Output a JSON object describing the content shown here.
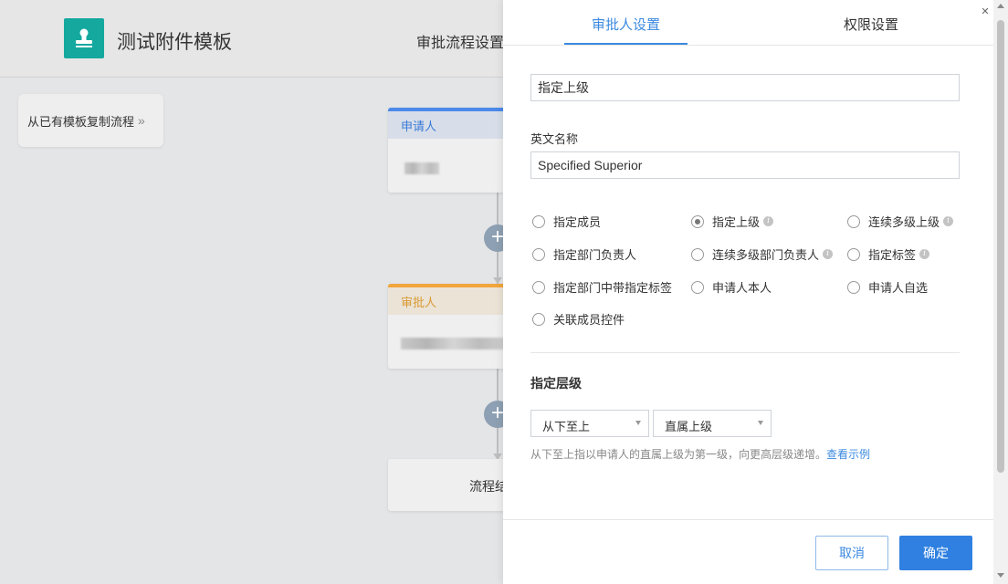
{
  "app": {
    "title": "测试附件模板",
    "top_tab": "审批流程设置",
    "copy_button": "从已有模板复制流程",
    "copy_chevron": "»",
    "logo_icon": "stamp-icon"
  },
  "flow": {
    "node1_label": "申请人",
    "node2_label": "审批人",
    "end_label": "流程结",
    "plus_glyph": "+"
  },
  "panel": {
    "tabs": [
      {
        "label": "审批人设置",
        "active": true
      },
      {
        "label": "权限设置",
        "active": false
      }
    ],
    "close_glyph": "✕",
    "name_value": "指定上级",
    "en_name_label": "英文名称",
    "en_name_value": "Specified Superior",
    "radio_options": [
      {
        "label": "指定成员",
        "checked": false,
        "info": false
      },
      {
        "label": "指定上级",
        "checked": true,
        "info": true
      },
      {
        "label": "连续多级上级",
        "checked": false,
        "info": true
      },
      {
        "label": "指定部门负责人",
        "checked": false,
        "info": false
      },
      {
        "label": "连续多级部门负责人",
        "checked": false,
        "info": true
      },
      {
        "label": "指定标签",
        "checked": false,
        "info": true
      },
      {
        "label": "指定部门中带指定标签",
        "checked": false,
        "info": false
      },
      {
        "label": "申请人本人",
        "checked": false,
        "info": false
      },
      {
        "label": "申请人自选",
        "checked": false,
        "info": false
      },
      {
        "label": "关联成员控件",
        "checked": false,
        "info": false
      }
    ],
    "level_title": "指定层级",
    "select_direction": "从下至上",
    "select_level": "直属上级",
    "hint_text": "从下至上指以申请人的直属上级为第一级，向更高层级递增。",
    "hint_link": "查看示例",
    "info_glyph": "i",
    "cancel_label": "取消",
    "ok_label": "确定"
  },
  "colors": {
    "accent": "#3c8ae0",
    "logo": "#14a89f",
    "approver": "#f2a53c"
  }
}
